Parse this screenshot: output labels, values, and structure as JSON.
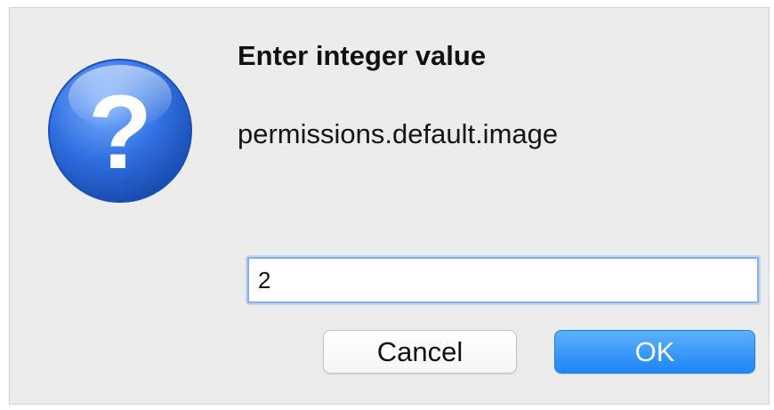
{
  "dialog": {
    "title": "Enter integer value",
    "message": "permissions.default.image",
    "input": {
      "value": "2",
      "placeholder": ""
    },
    "buttons": {
      "cancel_label": "Cancel",
      "ok_label": "OK"
    },
    "icon": {
      "name": "question-mark-icon",
      "glyph": "?",
      "color": "#2f6fe0"
    },
    "colors": {
      "background": "#ececec",
      "accent": "#1e86f6",
      "input_focus": "#7fb2ee"
    }
  }
}
